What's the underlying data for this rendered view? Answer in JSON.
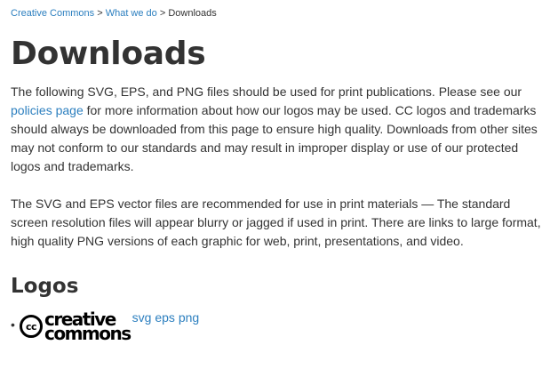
{
  "breadcrumb": {
    "items": [
      "Creative Commons",
      "What we do"
    ],
    "separator": ">",
    "current": "Downloads"
  },
  "page_title": "Downloads",
  "intro": {
    "before_link": "The following SVG, EPS, and PNG files should be used for print publications. Please see our ",
    "link_text": "policies page",
    "after_link": " for more information about how our logos may be used. CC logos and trademarks should always be downloaded from this page to ensure high quality. Downloads from other sites may not conform to our standards and may result in improper display or use of our protected logos and trademarks."
  },
  "vector_note": "The SVG and EPS vector files are recommended for use in print materials — The standard screen resolution files will appear blurry or jagged if used in print. There are links to large format, high quality PNG versions of each graphic for web, print, presentations, and video.",
  "logos_section": {
    "heading": "Logos",
    "items": [
      {
        "logo": {
          "badge": "cc",
          "word1": "creative",
          "word2": "commons"
        },
        "bullet": "•",
        "formats": [
          "svg",
          "eps",
          "png"
        ]
      }
    ]
  },
  "colors": {
    "link": "#2c7fbf",
    "text": "#333333"
  }
}
